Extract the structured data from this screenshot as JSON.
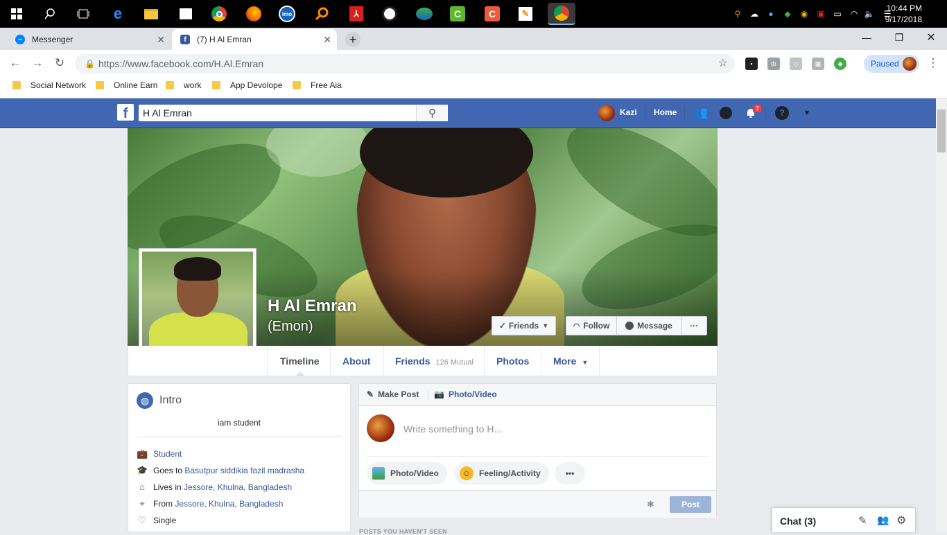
{
  "taskbar": {
    "time": "10:44 PM",
    "date": "9/17/2018",
    "apps": [
      "start-icon",
      "search-icon",
      "task-view-icon",
      "edge-icon",
      "file-explorer-icon",
      "store-icon",
      "chrome-icon",
      "firefox-icon",
      "imo-icon",
      "search-app-icon",
      "acrobat-icon",
      "tuxpaint-icon",
      "idm-icon",
      "camtasia-icon",
      "camtasia-recorder-icon",
      "unknown-app-icon",
      "chrome-profile-icon"
    ],
    "imo_label": "imo"
  },
  "browser": {
    "tabs": [
      {
        "title": "Messenger",
        "icon": "messenger-icon",
        "active": false
      },
      {
        "title": "(7) H Al Emran",
        "icon": "facebook-icon",
        "active": true
      }
    ],
    "url": "https://www.facebook.com/H.Al.Emran",
    "paused_label": "Paused",
    "bookmarks": [
      "Social Network",
      "Online Earn",
      "work",
      "App Devolope",
      "Free Aia"
    ]
  },
  "fb": {
    "search_value": "H Al Emran",
    "user_name": "Kazi",
    "home_label": "Home",
    "notification_count": "7",
    "colors": {
      "brand": "#4267b2",
      "link": "#365899"
    }
  },
  "profile": {
    "name": "H Al Emran",
    "alt_name": "(Emon)",
    "buttons": {
      "friends": "Friends",
      "follow": "Follow",
      "message": "Message",
      "more": "···"
    },
    "nav": {
      "timeline": "Timeline",
      "about": "About",
      "friends": "Friends",
      "mutual": "126 Mutual",
      "photos": "Photos",
      "more": "More"
    }
  },
  "intro": {
    "title": "Intro",
    "bio": "iam student",
    "items": [
      {
        "icon": "briefcase-icon",
        "prefix": "",
        "link": "Student"
      },
      {
        "icon": "graduation-cap-icon",
        "prefix": "Goes to ",
        "link": "Basutpur siddikia fazil madrasha"
      },
      {
        "icon": "home-icon",
        "prefix": "Lives in ",
        "link": "Jessore, Khulna, Bangladesh"
      },
      {
        "icon": "location-pin-icon",
        "prefix": "From ",
        "link": "Jessore, Khulna, Bangladesh"
      },
      {
        "icon": "heart-icon",
        "prefix": "Single",
        "link": ""
      }
    ]
  },
  "composer": {
    "make_post": "Make Post",
    "photo_video_tab": "Photo/Video",
    "placeholder": "Write something to H...",
    "photo_video": "Photo/Video",
    "feeling": "Feeling/Activity",
    "post": "Post",
    "posts_below": "POSTS YOU HAVEN'T SEEN"
  },
  "chat": {
    "label": "Chat (3)"
  }
}
